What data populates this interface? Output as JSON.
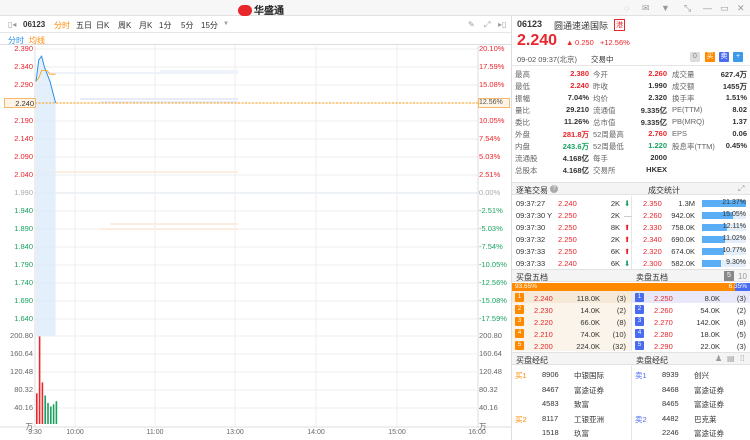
{
  "app": {
    "title": "华盛通",
    "window_icons": [
      "headset-icon",
      "mail-icon",
      "shirt-icon",
      "shrink-icon",
      "minimize-icon",
      "maximize-icon",
      "close-icon"
    ]
  },
  "toolbar": {
    "code": "06123",
    "tabs": [
      "分时",
      "五日",
      "日K",
      "周K",
      "月K",
      "1分",
      "5分",
      "15分"
    ],
    "active_tab": "分时"
  },
  "subtabs": [
    "分时",
    "均线"
  ],
  "chart_data": {
    "type": "line",
    "price_labels": [
      "2.390",
      "2.340",
      "2.290",
      "2.240",
      "2.190",
      "2.140",
      "2.090",
      "2.040",
      "1.990",
      "1.940",
      "1.890",
      "1.840",
      "1.790",
      "1.740",
      "1.690",
      "1.640"
    ],
    "pct_labels": [
      "20.10%",
      "17.59%",
      "15.08%",
      "12.56%",
      "10.05%",
      "7.54%",
      "5.03%",
      "2.51%",
      "0.00%",
      "-2.51%",
      "-5.03%",
      "-7.54%",
      "-10.05%",
      "-12.56%",
      "-15.08%",
      "-17.59%"
    ],
    "volume_labels": [
      "200.80",
      "160.64",
      "120.48",
      "80.32",
      "40.16",
      "万"
    ],
    "time_labels": [
      "9:30",
      "10:00",
      "11:00",
      "13:00",
      "14:00",
      "15:00",
      "16:00"
    ],
    "prev_close": 1.99,
    "current": 2.24,
    "current_label": "2.240",
    "current_pct_label": "12.56%",
    "ylim": [
      1.615,
      2.39
    ],
    "price_minutes": [
      0,
      1,
      2,
      3,
      4,
      5,
      6,
      7
    ],
    "prices": [
      2.3,
      2.36,
      2.37,
      2.34,
      2.32,
      2.3,
      2.27,
      2.24
    ],
    "avg_prices": [
      2.3,
      2.31,
      2.33,
      2.33,
      2.33,
      2.32,
      2.32,
      2.32
    ],
    "volume": [
      70,
      200,
      95,
      65,
      48,
      40,
      45,
      52
    ],
    "volume_up": [
      true,
      true,
      true,
      false,
      false,
      false,
      false,
      false
    ],
    "vol_max": 200.8
  },
  "quote": {
    "code": "06123",
    "name": "圆通速递国际",
    "badge": "港",
    "price": "2.240",
    "change": "0.250",
    "change_pct": "+12.56%",
    "time": "09-02 09:37(北京)",
    "status": "交易中",
    "buttons": [
      "0",
      "买",
      "卖",
      "+"
    ],
    "stats": [
      [
        [
          "最高",
          "2.380",
          "red"
        ],
        [
          "今开",
          "2.260",
          "red"
        ],
        [
          "成交量",
          "627.4万",
          ""
        ]
      ],
      [
        [
          "最低",
          "2.240",
          "red"
        ],
        [
          "昨收",
          "1.990",
          ""
        ],
        [
          "成交额",
          "1455万",
          ""
        ]
      ],
      [
        [
          "振幅",
          "7.04%",
          ""
        ],
        [
          "均价",
          "2.320",
          ""
        ],
        [
          "换手率",
          "1.51%",
          ""
        ]
      ],
      [
        [
          "量比",
          "29.210",
          ""
        ],
        [
          "流通值",
          "9.335亿",
          ""
        ],
        [
          "PE(TTM)",
          "8.02",
          ""
        ]
      ],
      [
        [
          "委比",
          "11.26%",
          ""
        ],
        [
          "总市值",
          "9.335亿",
          ""
        ],
        [
          "PB(MRQ)",
          "1.37",
          ""
        ]
      ],
      [
        [
          "外盘",
          "281.8万",
          "red"
        ],
        [
          "52周最高",
          "2.760",
          "red"
        ],
        [
          "EPS",
          "0.06",
          ""
        ]
      ],
      [
        [
          "内盘",
          "243.6万",
          "green"
        ],
        [
          "52周最低",
          "1.220",
          "green"
        ],
        [
          "股息率(TTM)",
          "0.45%",
          ""
        ]
      ],
      [
        [
          "流通股",
          "4.168亿",
          ""
        ],
        [
          "每手",
          "2000",
          ""
        ],
        [
          "",
          "",
          ""
        ]
      ],
      [
        [
          "总股本",
          "4.168亿",
          ""
        ],
        [
          "交易所",
          "HKEX",
          ""
        ],
        [
          "",
          "",
          ""
        ]
      ]
    ]
  },
  "trades": {
    "title": "逐笔交易",
    "rows": [
      [
        "09:37:27",
        "2.240",
        "2K",
        "down"
      ],
      [
        "09:37:30 Y",
        "2.250",
        "2K",
        "flat"
      ],
      [
        "09:37:30",
        "2.250",
        "8K",
        "up"
      ],
      [
        "09:37:32",
        "2.250",
        "2K",
        "up"
      ],
      [
        "09:37:33",
        "2.250",
        "6K",
        "up"
      ],
      [
        "09:37:33",
        "2.240",
        "6K",
        "down"
      ]
    ]
  },
  "volume_stats": {
    "title": "成交统计",
    "rows": [
      [
        "2.350",
        "1.3M",
        "21.37%",
        21.37
      ],
      [
        "2.260",
        "942.0K",
        "15.05%",
        15.05
      ],
      [
        "2.330",
        "758.0K",
        "12.11%",
        12.11
      ],
      [
        "2.340",
        "690.0K",
        "11.02%",
        11.02
      ],
      [
        "2.320",
        "674.0K",
        "10.77%",
        10.77
      ],
      [
        "2.300",
        "582.0K",
        "9.30%",
        9.3
      ]
    ]
  },
  "orderbook": {
    "bid_title": "买盘五档",
    "ask_title": "卖盘五档",
    "depth_options": [
      "5",
      "10"
    ],
    "bid_pct": "93.65%",
    "ask_pct": "6.35%",
    "bid_fraction": 0.9365,
    "bids": [
      [
        "1",
        "2.240",
        "118.0K",
        "(3)"
      ],
      [
        "2",
        "2.230",
        "14.0K",
        "(2)"
      ],
      [
        "3",
        "2.220",
        "66.0K",
        "(8)"
      ],
      [
        "4",
        "2.210",
        "74.0K",
        "(10)"
      ],
      [
        "5",
        "2.200",
        "224.0K",
        "(32)"
      ]
    ],
    "asks": [
      [
        "1",
        "2.250",
        "8.0K",
        "(3)"
      ],
      [
        "2",
        "2.260",
        "54.0K",
        "(2)"
      ],
      [
        "3",
        "2.270",
        "142.0K",
        "(8)"
      ],
      [
        "4",
        "2.280",
        "18.0K",
        "(5)"
      ],
      [
        "5",
        "2.290",
        "22.0K",
        "(3)"
      ]
    ]
  },
  "brokers": {
    "bid_title": "买盘经纪",
    "ask_title": "卖盘经纪",
    "bids": [
      [
        "买1",
        "8906",
        "中银国际"
      ],
      [
        "",
        "8467",
        "富途证券"
      ],
      [
        "",
        "4583",
        "致富"
      ],
      [
        "买2",
        "8117",
        "工银亚洲"
      ],
      [
        "",
        "1518",
        "玖富"
      ]
    ],
    "asks": [
      [
        "卖1",
        "8939",
        "创兴"
      ],
      [
        "",
        "8468",
        "富途证券"
      ],
      [
        "",
        "8465",
        "富途证券"
      ],
      [
        "卖2",
        "4482",
        "巴克莱"
      ],
      [
        "",
        "2246",
        "富途证券"
      ]
    ]
  },
  "colors": {
    "up": "#e8262b",
    "down": "#1aa260",
    "accent": "#ff8a00",
    "line": "#2b8fe8",
    "bar": "#5aaef5"
  }
}
